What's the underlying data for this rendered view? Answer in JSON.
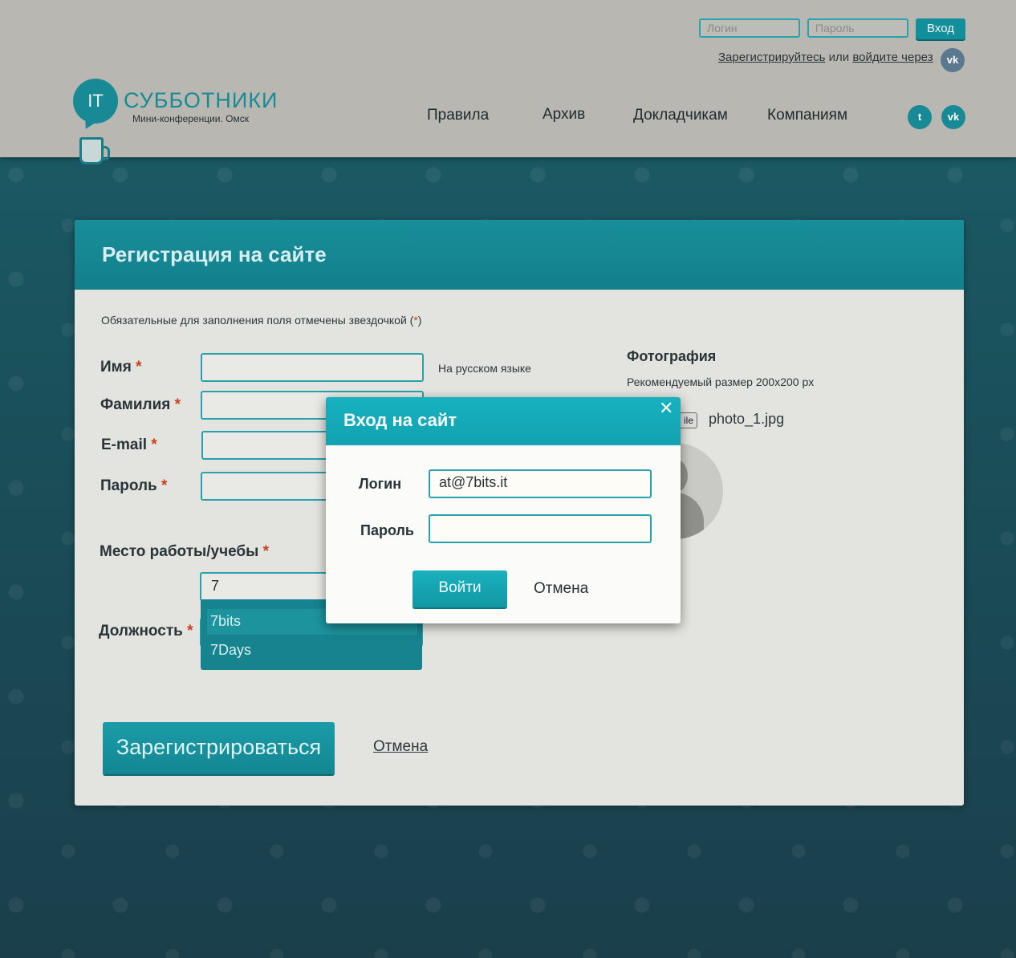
{
  "header": {
    "login_placeholder": "Логин",
    "password_placeholder": "Пароль",
    "login_button": "Вход",
    "register_link": "Зарегистрируйтесь",
    "or_text": "или",
    "social_login_link": "войдите через",
    "vk_icon_text": "vk",
    "logo_it": "IT",
    "logo_title": "СУББОТНИКИ",
    "logo_subtitle": "Мини-конференции. Омск",
    "nav": [
      "Правила",
      "Архив",
      "Докладчикам",
      "Компаниям"
    ],
    "social_twitter": "t",
    "social_vk": "vk"
  },
  "form": {
    "title": "Регистрация на сайте",
    "required_note_prefix": "Обязательные для заполнения поля отмечены звездочкой (",
    "required_note_star": "*",
    "required_note_suffix": ")",
    "star": "*",
    "labels": {
      "first_name": "Имя",
      "last_name": "Фамилия",
      "email": "E-mail",
      "password": "Пароль",
      "workplace": "Место работы/учебы",
      "position": "Должность"
    },
    "first_name_hint": "На русском языке",
    "workplace_value": "7",
    "workplace_suggestions": [
      "7bits",
      "7Days"
    ],
    "submit_button": "Зарегистрироваться",
    "cancel_link": "Отмена",
    "photo": {
      "title": "Фотография",
      "hint": "Рекомендуемый размер 200x200 px",
      "file_button_fragment": "ile",
      "file_name": "photo_1.jpg"
    }
  },
  "login_modal": {
    "title": "Вход на сайт",
    "close": "✕",
    "login_label": "Логин",
    "login_value": "at@7bits.it",
    "password_label": "Пароль",
    "password_value": "",
    "submit_button": "Войти",
    "cancel_button": "Отмена"
  },
  "colors": {
    "accent": "#178a95",
    "header_bg": "#b8b7b1",
    "page_bg": "#1b5e68",
    "required_star": "#c8401c"
  }
}
